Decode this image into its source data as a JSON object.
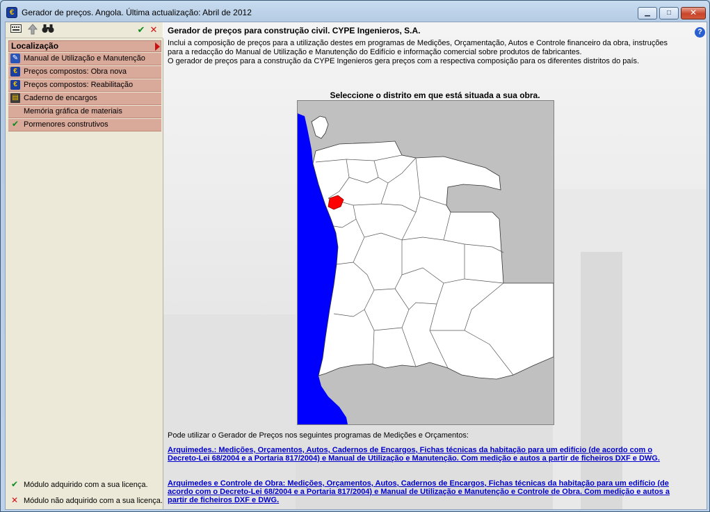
{
  "window": {
    "title": "Gerador de preços. Angola. Última actualização: Abril de 2012",
    "icon": "euro-app-icon",
    "controls": {
      "minimize": "▁",
      "maximize": "□",
      "close": "✕"
    }
  },
  "toolbar": {
    "icons": [
      "keyboard-icon",
      "up-arrow-icon",
      "binoculars-icon"
    ],
    "ok_symbol": "✔",
    "cancel_symbol": "✕"
  },
  "sidebar": {
    "section_title": "Localização",
    "items": [
      {
        "label": "Manual de Utilização e Manutenção",
        "icon": "wrench-icon",
        "glyph": "✎"
      },
      {
        "label": "Preços compostos: Obra nova",
        "icon": "euro-icon",
        "glyph": "€"
      },
      {
        "label": "Preços compostos: Reabilitação",
        "icon": "euro-icon",
        "glyph": "€"
      },
      {
        "label": "Caderno de encargos",
        "icon": "book-icon",
        "glyph": "▤"
      },
      {
        "label": "Memória gráfica de materiais",
        "icon": "",
        "glyph": ""
      },
      {
        "label": "Pormenores construtivos",
        "icon": "check-icon",
        "glyph": "✔"
      }
    ],
    "legend": {
      "acquired_symbol": "✔",
      "acquired": "Módulo adquirido com a sua licença.",
      "not_acquired_symbol": "✕",
      "not_acquired": "Módulo não adquirido com a sua licença."
    }
  },
  "main": {
    "heading": "Gerador de preços para construção civil. CYPE Ingenieros, S.A.",
    "desc_line1": "Inclui a composição de preços para a utilização destes em programas de Medições, Orçamentação, Autos e Controle financeiro da obra, instruções para a redacção do Manual de Utilização e Manutenção do Edifício e informação comercial sobre produtos de fabricantes.",
    "desc_line2": "O gerador de preços para a construção da CYPE Ingenieros gera preços com a respectiva composição para os diferentes distritos do país.",
    "map_caption": "Seleccione o distrito em que está situada a sua obra.",
    "map_colors": {
      "sea": "#0000ff",
      "land": "#ffffff",
      "outside": "#c0c0c0",
      "selected": "#ff0000"
    },
    "programs_intro": "Pode utilizar o Gerador de Preços nos seguintes programas de Medições e Orçamentos:",
    "program_links": [
      "Arquimedes.: Medições, Orçamentos, Autos, Cadernos de Encargos, Fichas técnicas da habitação para um edifício (de acordo com o Decreto-Lei 68/2004 e a Portaria 817/2004) e Manual de Utilização e Manutenção. Com medição e autos a partir de ficheiros DXF e DWG.",
      "Arquimedes e Controle de Obra: Medições, Orçamentos, Autos, Cadernos de Encargos, Fichas técnicas da habitação para um edifício (de acordo com o Decreto-Lei 68/2004 e a Portaria 817/2004) e Manual de Utilização e Manutenção e Controle de Obra. Com medição e autos a partir de ficheiros DXF e DWG."
    ],
    "help_symbol": "?"
  }
}
